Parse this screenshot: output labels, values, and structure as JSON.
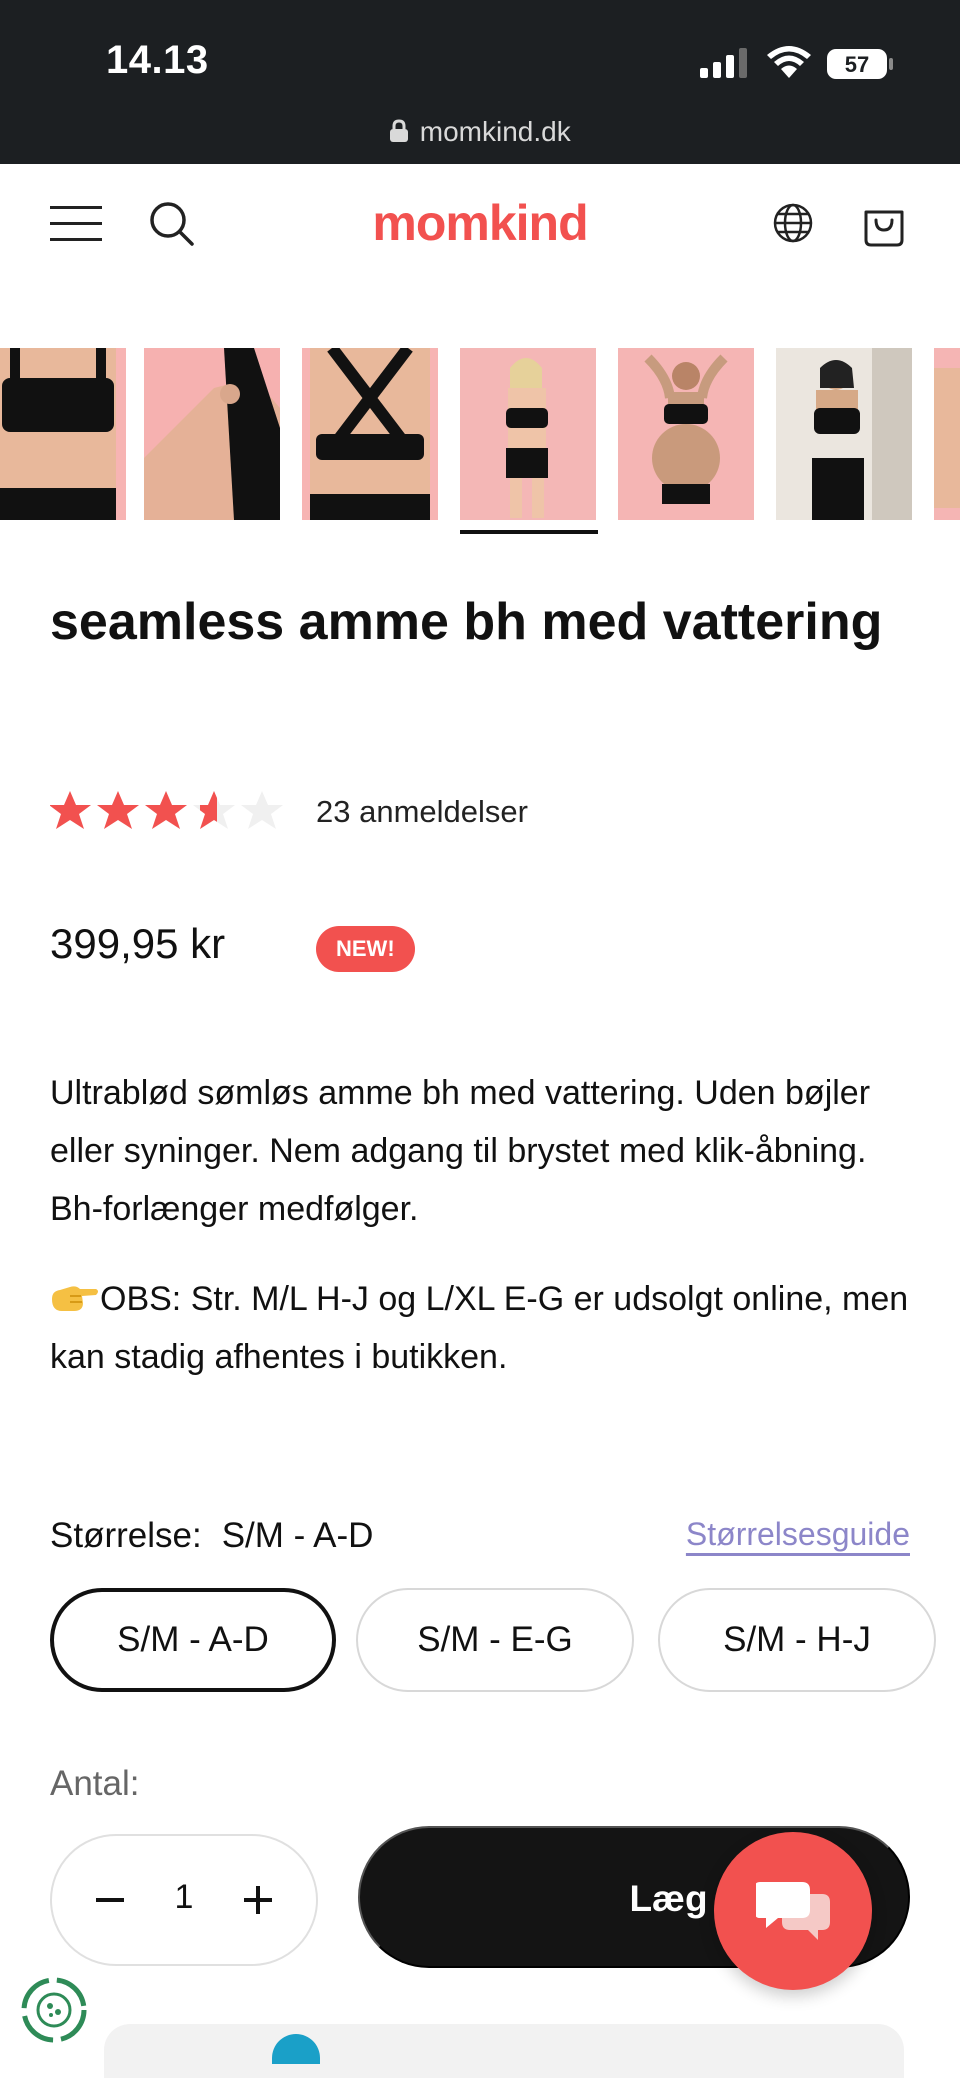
{
  "status_bar": {
    "time": "14.13",
    "battery": "57",
    "url": "momkind.dk"
  },
  "header": {
    "logo": "momkind"
  },
  "gallery": {
    "thumbnails": [
      "back view bra",
      "strap clip detail",
      "racerback view",
      "model front view",
      "pregnant model",
      "model in living room"
    ],
    "selected_index": 3
  },
  "product": {
    "title": "seamless amme bh med vattering",
    "rating": 3.5,
    "rating_max": 5,
    "review_count": "23 anmeldelser",
    "price": "399,95 kr",
    "badge": "NEW!",
    "description": "Ultrablød sømløs amme bh med vattering. Uden bøjler eller syninger. Nem adgang til brystet med klik-åbning. Bh-forlænger medfølger.",
    "obs": "OBS: Str. M/L H-J og L/XL E-G er udsolgt online, men kan stadig afhentes i butikken."
  },
  "size": {
    "label": "Størrelse:",
    "selected": "S/M - A-D",
    "guide": "Størrelsesguide",
    "options": [
      "S/M - A-D",
      "S/M - E-G",
      "S/M - H-J"
    ]
  },
  "quantity": {
    "label": "Antal:",
    "value": "1"
  },
  "cart": {
    "label": "Læg i kurv"
  },
  "colors": {
    "brand": "#f2514f",
    "link": "#8c86c9",
    "dark": "#141414"
  }
}
